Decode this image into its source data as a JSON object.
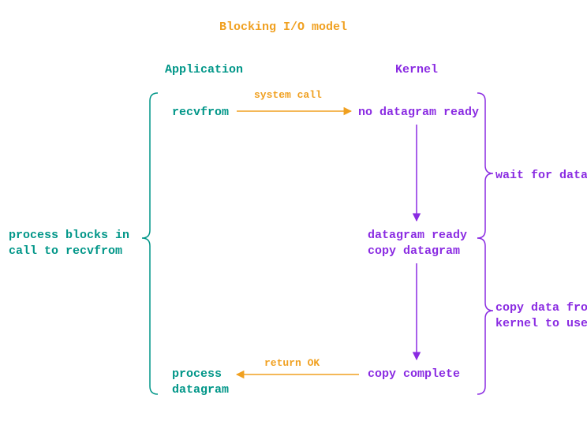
{
  "title": "Blocking I/O model",
  "headers": {
    "app": "Application",
    "kernel": "Kernel"
  },
  "app_col": {
    "recvfrom": "recvfrom",
    "process_datagram_l1": "process",
    "process_datagram_l2": "datagram"
  },
  "kernel_col": {
    "no_ready": "no datagram ready",
    "ready_l1": "datagram ready",
    "ready_l2": "copy datagram",
    "copy_complete": "copy complete"
  },
  "arrows": {
    "syscall": "system call",
    "return_ok": "return OK"
  },
  "left_note_l1": "process blocks in",
  "left_note_l2": "call to recvfrom",
  "right_note_wait": "wait for data",
  "right_note_copy_l1": "copy data from",
  "right_note_copy_l2": "kernel to user"
}
